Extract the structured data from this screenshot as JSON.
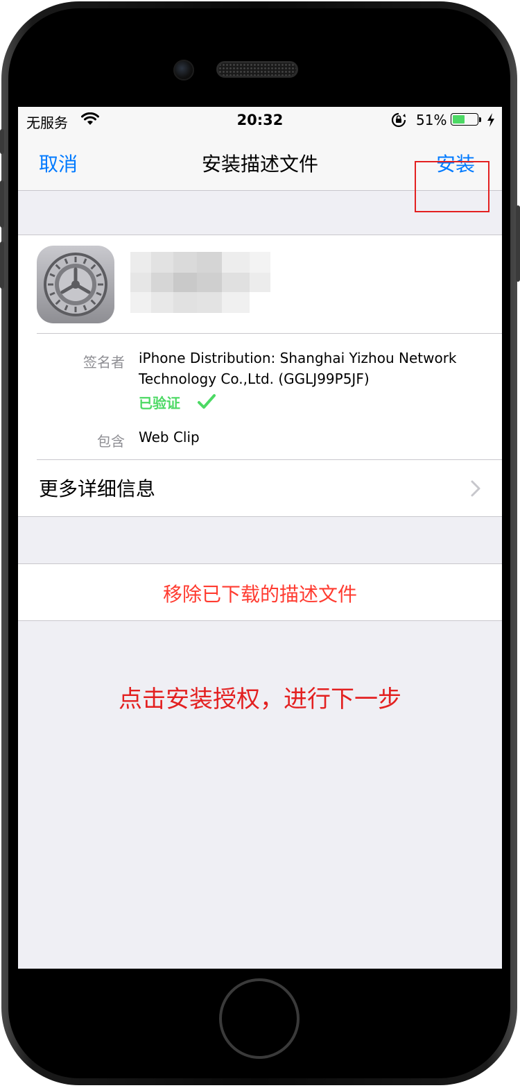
{
  "status_bar": {
    "carrier": "无服务",
    "time": "20:32",
    "battery_percent": "51%",
    "battery_level": 0.51,
    "wifi_icon": "wifi-icon",
    "lock_icon": "rotation-lock-icon",
    "charging_icon": "charging-bolt-icon"
  },
  "nav": {
    "cancel_label": "取消",
    "title": "安装描述文件",
    "install_label": "安装"
  },
  "profile": {
    "icon": "settings-gear-icon",
    "signer_label": "签名者",
    "signer_value_line1": "iPhone Distribution: Shanghai Yizhou Network",
    "signer_value_line2": "Technology Co.,Ltd. (GGLJ99P5JF)",
    "verified_label": "已验证",
    "contains_label": "包含",
    "contains_value": "Web Clip",
    "more_details_label": "更多详细信息"
  },
  "remove": {
    "label": "移除已下载的描述文件"
  },
  "annotation": {
    "text": "点击安装授权，进行下一步"
  },
  "colors": {
    "accent": "#007aff",
    "destructive": "#ff3b30",
    "verified": "#4cd964",
    "annotation": "#e32020",
    "background": "#efeff4"
  }
}
